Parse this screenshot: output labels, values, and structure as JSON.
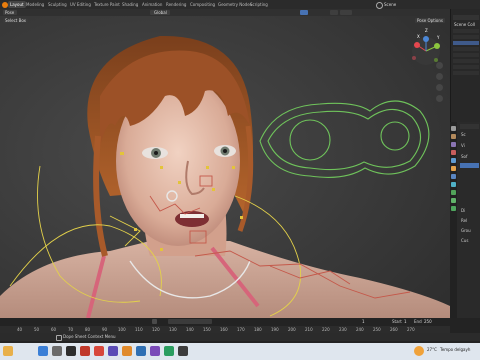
{
  "app": {
    "name": "Blender"
  },
  "topbar": {
    "menus": [
      "File",
      "Edit",
      "Render",
      "Window",
      "Help"
    ],
    "tabs": [
      "Layout",
      "Modeling",
      "Sculpting",
      "UV Editing",
      "Texture Paint",
      "Shading",
      "Animation",
      "Rendering",
      "Compositing",
      "Geometry Nodes",
      "Scripting"
    ],
    "active_tab": "Layout",
    "scene_label": "Scene"
  },
  "viewport": {
    "mode": "Pose",
    "orientation": "Global",
    "select_box": "Select Box",
    "pose_options": "Pose Options",
    "gizmo_axes": [
      "Y",
      "X",
      "Z"
    ]
  },
  "outliner": {
    "title": "Scene Coll"
  },
  "properties": {
    "items": [
      "Sc",
      "Vi",
      "Sof",
      "Di",
      "Rel",
      "Grou",
      "Cus"
    ]
  },
  "timeline": {
    "frames": [
      "40",
      "50",
      "60",
      "70",
      "80",
      "90",
      "100",
      "110",
      "120",
      "130",
      "140",
      "150",
      "160",
      "170",
      "180",
      "190",
      "200",
      "210",
      "220",
      "230",
      "240",
      "250",
      "260",
      "270"
    ],
    "current_frame": "1",
    "start_label": "Start",
    "start_value": "1",
    "end_label": "End",
    "end_value": "250"
  },
  "statusbar": {
    "context_menu": "Dope Sheet Context Menu"
  },
  "taskbar": {
    "weather_temp": "27°C",
    "weather_text": "Tempo delgayh"
  },
  "colors": {
    "accent": "#4772b3",
    "active_tab_bg": "#454545",
    "viewport_bg": "#3d3d3d"
  }
}
